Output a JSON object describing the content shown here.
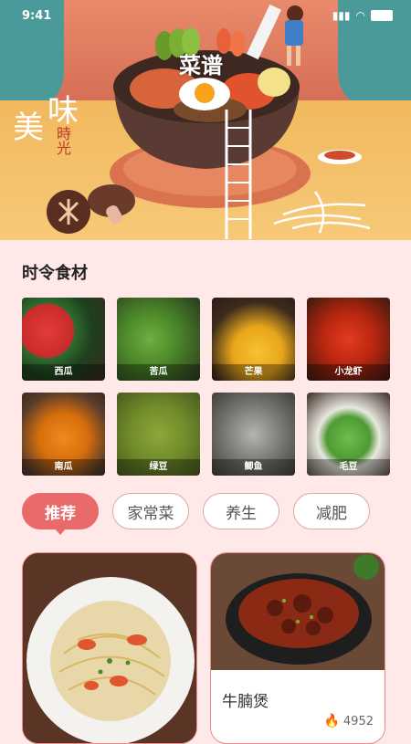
{
  "status_bar": {
    "time": "9:41"
  },
  "hero": {
    "title": "菜谱",
    "calligraphy_big_1": "美",
    "calligraphy_big_2": "味",
    "calligraphy_small": "時光"
  },
  "seasonal": {
    "title": "时令食材",
    "items": [
      {
        "label": "西瓜",
        "icon": "watermelon"
      },
      {
        "label": "苦瓜",
        "icon": "bitter-melon"
      },
      {
        "label": "芒果",
        "icon": "mango"
      },
      {
        "label": "小龙虾",
        "icon": "crayfish"
      },
      {
        "label": "南瓜",
        "icon": "pumpkin"
      },
      {
        "label": "绿豆",
        "icon": "mung-bean"
      },
      {
        "label": "鲫鱼",
        "icon": "crucian-carp"
      },
      {
        "label": "毛豆",
        "icon": "edamame"
      }
    ]
  },
  "tabs": [
    {
      "label": "推荐",
      "active": true
    },
    {
      "label": "家常菜",
      "active": false
    },
    {
      "label": "养生",
      "active": false
    },
    {
      "label": "减肥",
      "active": false
    }
  ],
  "recipes": [
    {
      "name": "",
      "likes": ""
    },
    {
      "name": "牛腩煲",
      "likes": "4952"
    }
  ],
  "colors": {
    "accent": "#e96a6a",
    "background": "#ffe8e8"
  }
}
